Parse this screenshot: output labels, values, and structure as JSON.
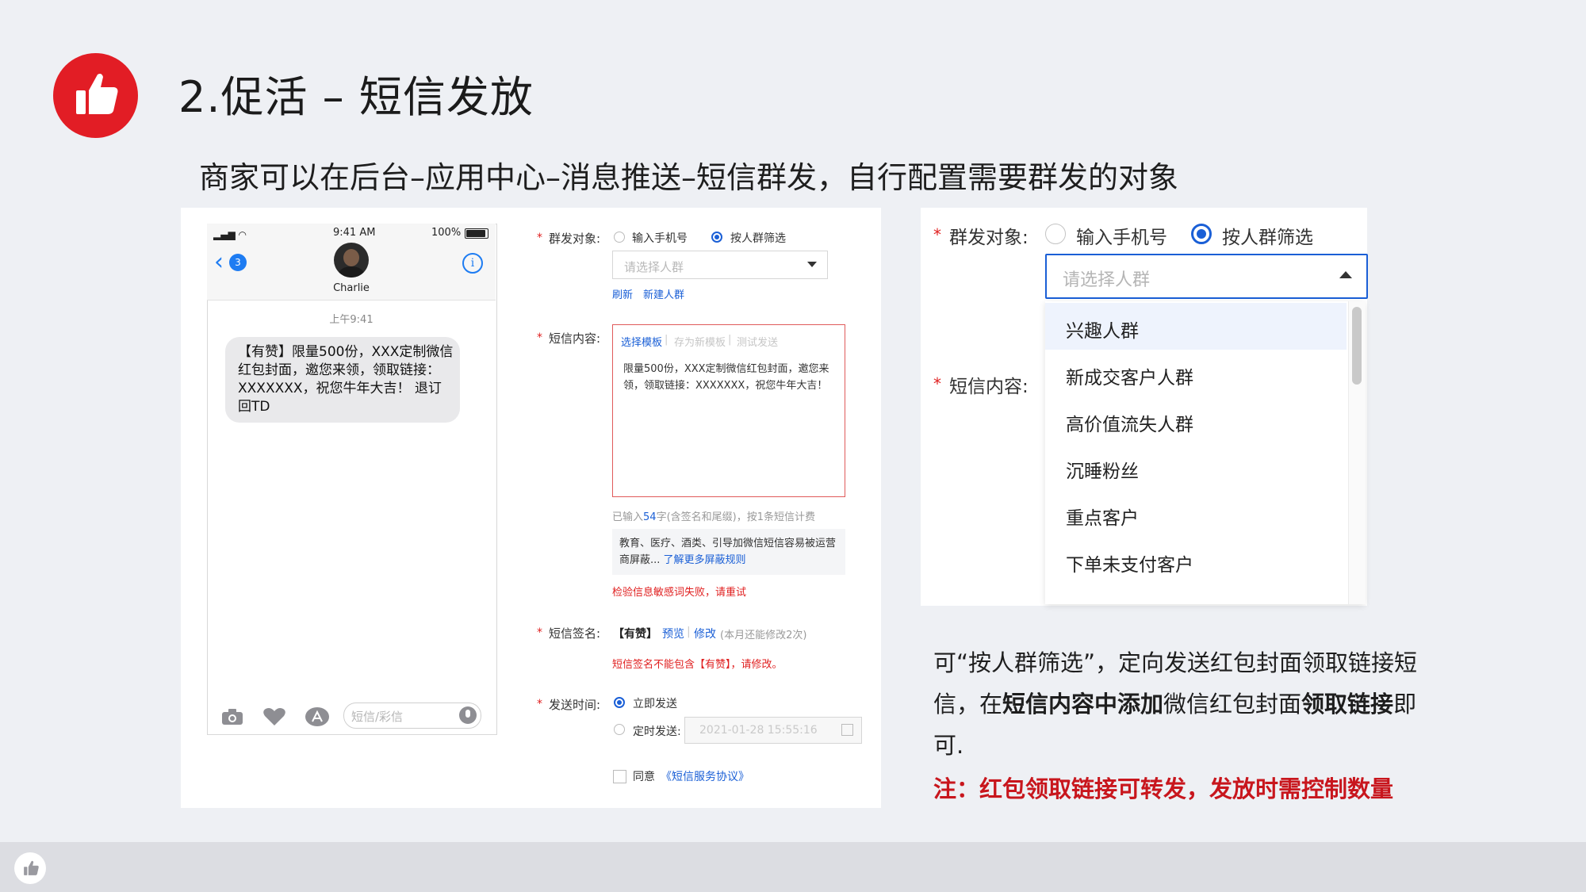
{
  "header": {
    "title": "2.促活 – 短信发放",
    "subtitle": "商家可以在后台–应用中心–消息推送–短信群发，自行配置需要群发的对象"
  },
  "colors": {
    "brand_red": "#e21d25",
    "link_blue": "#1a5fd6",
    "error_red": "#e02020",
    "note_red": "#c8161d"
  },
  "phone": {
    "status_time": "9:41 AM",
    "battery": "100%",
    "back_badge": "3",
    "contact_name": "Charlie",
    "message_time": "上午9:41",
    "message": "【有赞】限量500份，XXX定制微信红包封面，邀您来领，领取链接：XXXXXXX，祝您牛年大吉！ 退订回TD",
    "input_placeholder": "短信/彩信"
  },
  "form": {
    "target_label": "群发对象:",
    "option_phone": "输入手机号",
    "option_crowd": "按人群筛选",
    "select_placeholder": "请选择人群",
    "refresh": "刷新",
    "new_crowd": "新建人群",
    "content_label": "短信内容:",
    "template_choose": "选择模板",
    "template_save": "存为新模板",
    "test_send": "测试发送",
    "content_text": "限量500份，XXX定制微信红包封面，邀您来领，领取链接：XXXXXXX，祝您牛年大吉！",
    "count_prefix": "已输入",
    "count_num": "54",
    "count_suffix": "字(含签名和尾缀)，按1条短信计费",
    "tip_text": "教育、医疗、酒类、引导加微信短信容易被运营商屏蔽... ",
    "tip_link": "了解更多屏蔽规则",
    "check_fail": "检验信息敏感词失败，请重试",
    "sign_label": "短信签名:",
    "sign_value": "【有赞】",
    "sign_preview": "预览",
    "sign_edit": "修改",
    "sign_remaining": "(本月还能修改2次)",
    "sign_error": "短信签名不能包含【有赞】，请修改。",
    "time_label": "发送时间:",
    "send_now": "立即发送",
    "send_scheduled": "定时发送:",
    "date_placeholder": "2021-01-28 15:55:16",
    "agree": "同意",
    "agreement": "《短信服务协议》"
  },
  "right_panel": {
    "target_label": "群发对象:",
    "option_phone": "输入手机号",
    "option_crowd": "按人群筛选",
    "select_placeholder": "请选择人群",
    "content_label": "短信内容:",
    "options": [
      "兴趣人群",
      "新成交客户人群",
      "高价值流失人群",
      "沉睡粉丝",
      "重点客户",
      "下单未支付客户"
    ]
  },
  "explanation": {
    "p1": "可“按人群筛选”，定向发送红包封面领取链接短信，在",
    "b1": "短信内容中添加",
    "p2": "微信红包封面",
    "b2": "领取链接",
    "p3": "即可.",
    "note": "注：红包领取链接可转发，发放时需控制数量"
  }
}
